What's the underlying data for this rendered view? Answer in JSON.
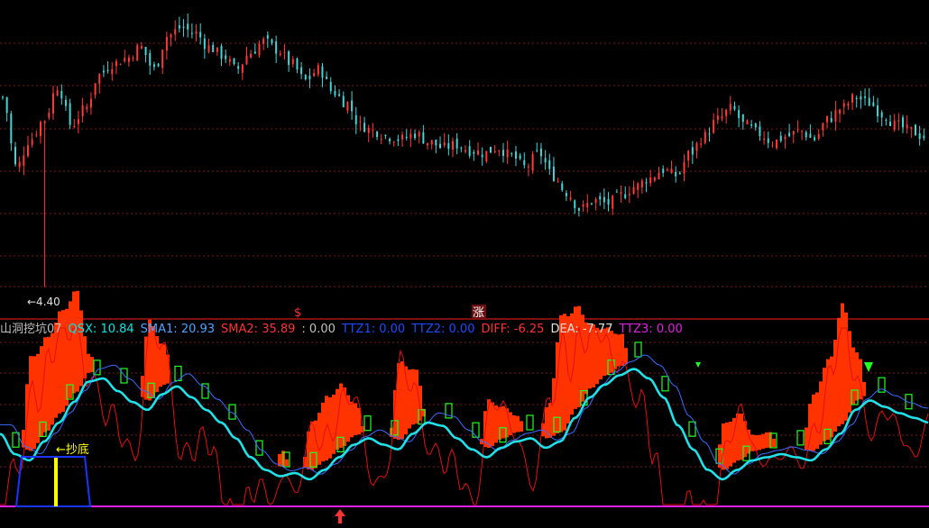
{
  "price_panel": {
    "low_marker_label": "←4.40",
    "signal_labels": [
      "$",
      "涨"
    ],
    "signal_colors": [
      "#ff3333",
      "#ff3333"
    ]
  },
  "indicator_legend": [
    {
      "text": "山洞挖坑07",
      "color": "#c0c0c0"
    },
    {
      "text": "QSX: 10.84",
      "color": "#00e5e5"
    },
    {
      "text": "SMA1: 20.93",
      "color": "#4da3ff"
    },
    {
      "text": "SMA2: 35.89",
      "color": "#ff3333"
    },
    {
      "text": ": 0.00",
      "color": "#c0c0c0"
    },
    {
      "text": "TTZ1: 0.00",
      "color": "#1a4cff"
    },
    {
      "text": "TTZ2: 0.00",
      "color": "#1a4cff"
    },
    {
      "text": "DIFF: -6.25",
      "color": "#ff3333"
    },
    {
      "text": "DEA: -7.77",
      "color": "#e0e0e0"
    },
    {
      "text": "TTZ3: 0.00",
      "color": "#e020e0"
    }
  ],
  "bottom_label": "←抄底",
  "colors": {
    "up": "#ff3a3a",
    "down": "#45d4d4",
    "grid": "#7a1a1a",
    "separator": "#ff2020",
    "qsx": "#22e0e8",
    "sma1": "#3b6cff",
    "sma2": "#e01010",
    "bars": "#ff3300",
    "boxes": "#22ff22",
    "baseline": "#e020e0",
    "bottom_box": "#1a33ff",
    "bottom_bar": "#ffff00"
  },
  "chart_data": [
    {
      "type": "candlestick",
      "low_annotation": 4.4,
      "close_profile": [
        0.7,
        0.45,
        0.55,
        0.62,
        0.74,
        0.6,
        0.66,
        0.78,
        0.82,
        0.84,
        0.88,
        0.8,
        0.92,
        0.95,
        0.93,
        0.88,
        0.85,
        0.8,
        0.86,
        0.9,
        0.87,
        0.82,
        0.76,
        0.8,
        0.72,
        0.68,
        0.6,
        0.58,
        0.56,
        0.55,
        0.57,
        0.54,
        0.52,
        0.53,
        0.51,
        0.5,
        0.52,
        0.49,
        0.45,
        0.5,
        0.42,
        0.36,
        0.3,
        0.33,
        0.32,
        0.35,
        0.38,
        0.41,
        0.44,
        0.42,
        0.5,
        0.56,
        0.62,
        0.66,
        0.6,
        0.57,
        0.54,
        0.56,
        0.58,
        0.55,
        0.62,
        0.66,
        0.7,
        0.68,
        0.64,
        0.6,
        0.58,
        0.56
      ]
    },
    {
      "type": "line",
      "series": [
        {
          "name": "QSX"
        },
        {
          "name": "SMA1"
        },
        {
          "name": "SMA2"
        }
      ],
      "qsx_profile": [
        0.45,
        0.32,
        0.28,
        0.4,
        0.52,
        0.65,
        0.78,
        0.8,
        0.72,
        0.65,
        0.6,
        0.7,
        0.75,
        0.68,
        0.6,
        0.52,
        0.42,
        0.3,
        0.22,
        0.18,
        0.2,
        0.16,
        0.22,
        0.3,
        0.38,
        0.42,
        0.38,
        0.35,
        0.45,
        0.52,
        0.5,
        0.42,
        0.35,
        0.3,
        0.36,
        0.4,
        0.42,
        0.36,
        0.4,
        0.55,
        0.68,
        0.76,
        0.82,
        0.86,
        0.8,
        0.68,
        0.5,
        0.35,
        0.22,
        0.16,
        0.22,
        0.28,
        0.3,
        0.32,
        0.3,
        0.28,
        0.35,
        0.45,
        0.6,
        0.66,
        0.62,
        0.58,
        0.55,
        0.52
      ]
    }
  ]
}
